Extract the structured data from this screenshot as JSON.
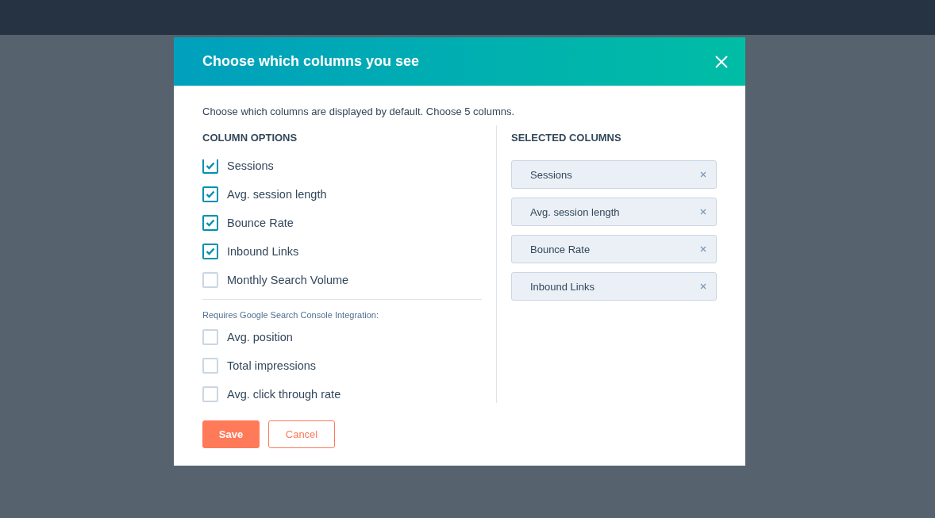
{
  "modal": {
    "title": "Choose which columns you see",
    "intro": "Choose which columns are displayed by default. Choose 5 columns.",
    "column_options": {
      "heading": "COLUMN OPTIONS",
      "items": [
        {
          "label": "Sessions",
          "checked": true
        },
        {
          "label": "Avg. session length",
          "checked": true
        },
        {
          "label": "Bounce Rate",
          "checked": true
        },
        {
          "label": "Inbound Links",
          "checked": true
        },
        {
          "label": "Monthly Search Volume",
          "checked": false
        }
      ],
      "group_note": "Requires Google Search Console Integration:",
      "group_items": [
        {
          "label": "Avg. position",
          "checked": false
        },
        {
          "label": "Total impressions",
          "checked": false
        },
        {
          "label": "Avg. click through rate",
          "checked": false
        }
      ]
    },
    "selected_columns": {
      "heading": "SELECTED COLUMNS",
      "items": [
        "Sessions",
        "Avg. session length",
        "Bounce Rate",
        "Inbound Links"
      ]
    },
    "buttons": {
      "save": "Save",
      "cancel": "Cancel"
    }
  }
}
